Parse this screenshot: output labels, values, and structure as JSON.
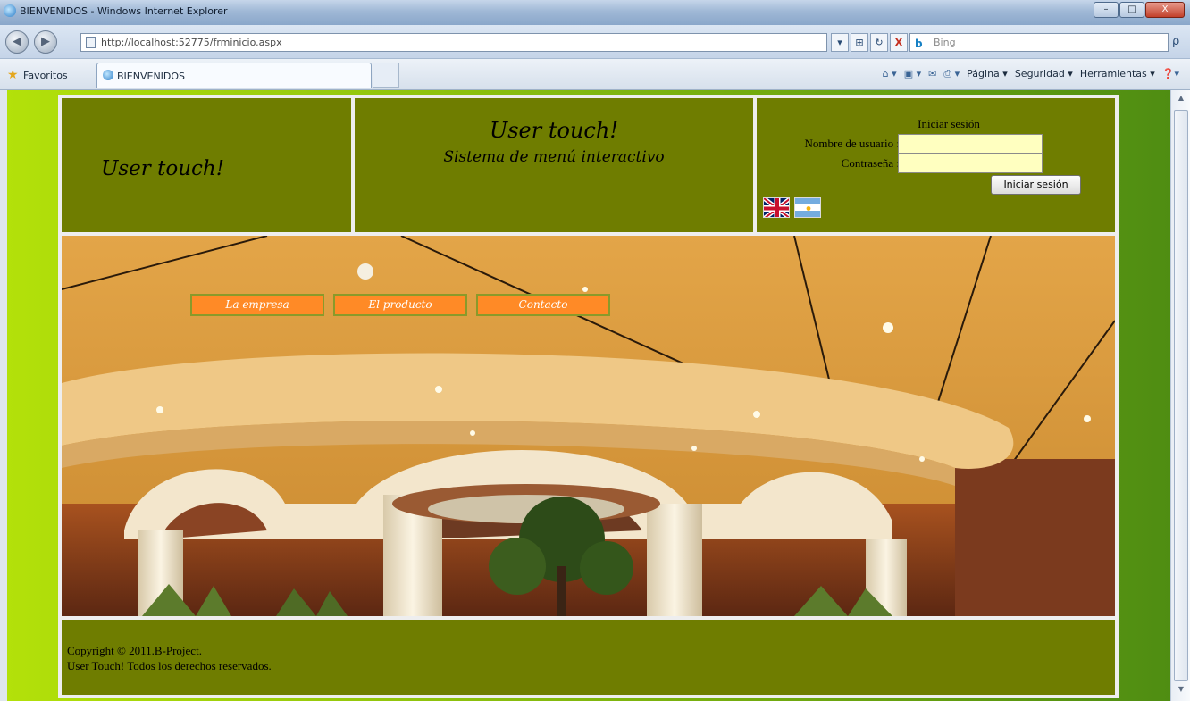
{
  "window": {
    "title": "BIENVENIDOS - Windows Internet Explorer",
    "minimize": "–",
    "maximize": "□",
    "close": "X"
  },
  "address_bar": {
    "back": "◀",
    "forward": "▶",
    "url": "http://localhost:52775/frminicio.aspx",
    "search_placeholder": "Bing",
    "bing_logo": "b",
    "search_go": "ρ",
    "dropdown": "▾",
    "compat": "⊞",
    "refresh": "↻",
    "stop": "X"
  },
  "favorites_bar": {
    "favorites_label": "Favoritos",
    "tab_title": "BIENVENIDOS",
    "commands": [
      "Página ▾",
      "Seguridad ▾",
      "Herramientas ▾"
    ],
    "command_icons": [
      "⌂ ▾",
      "▣ ▾",
      "✉",
      "⎙ ▾"
    ],
    "help": "❓▾"
  },
  "header": {
    "logo_text": "User touch!",
    "brand_title": "User touch!",
    "brand_subtitle": "Sistema de menú interactivo"
  },
  "login": {
    "heading": "Iniciar sesión",
    "username_label": "Nombre de usuario :",
    "password_label": "Contraseña :",
    "username_value": "",
    "password_value": "",
    "submit_label": "Iniciar sesión"
  },
  "menu": {
    "items": [
      "La empresa",
      "El producto",
      "Contacto"
    ]
  },
  "footer": {
    "line1": "Copyright © 2011.B-Project.",
    "line2": "User Touch! Todos los derechos reservados."
  },
  "colors": {
    "header_bg": "#6f7d00",
    "menu_button": "#ff8a26",
    "input_bg": "#ffffc0"
  }
}
